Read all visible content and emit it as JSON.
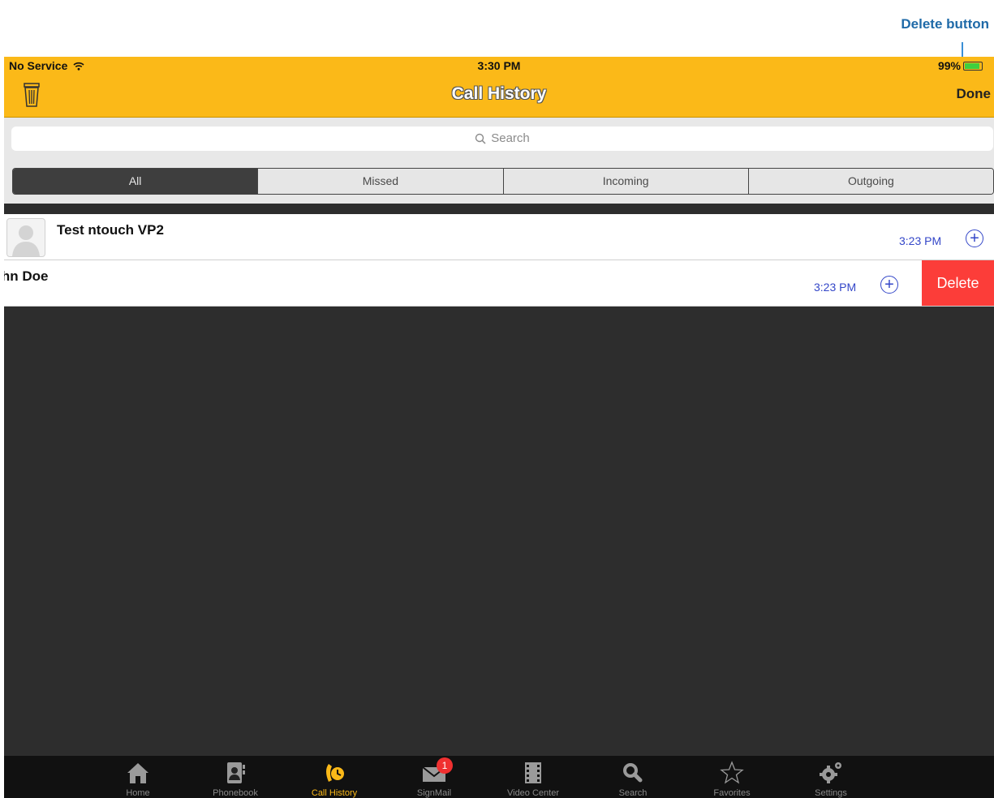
{
  "annotation": {
    "label": "Delete button"
  },
  "status_bar": {
    "carrier": "No Service",
    "time": "3:30 PM",
    "battery": "99%"
  },
  "nav": {
    "title": "Call History",
    "done_label": "Done"
  },
  "search": {
    "placeholder": "Search"
  },
  "segments": [
    {
      "label": "All",
      "active": true
    },
    {
      "label": "Missed",
      "active": false
    },
    {
      "label": "Incoming",
      "active": false
    },
    {
      "label": "Outgoing",
      "active": false
    }
  ],
  "calls": [
    {
      "name": "Test ntouch VP2",
      "time": "3:23 PM"
    },
    {
      "name": "John Doe",
      "time": "3:23 PM",
      "delete_label": "Delete"
    }
  ],
  "tabs": [
    {
      "label": "Home",
      "icon": "home-icon"
    },
    {
      "label": "Phonebook",
      "icon": "phonebook-icon"
    },
    {
      "label": "Call History",
      "icon": "call-history-icon",
      "active": true
    },
    {
      "label": "SignMail",
      "icon": "signmail-icon",
      "badge": "1"
    },
    {
      "label": "Video Center",
      "icon": "video-center-icon"
    },
    {
      "label": "Search",
      "icon": "search-icon"
    },
    {
      "label": "Favorites",
      "icon": "favorites-icon"
    },
    {
      "label": "Settings",
      "icon": "settings-icon"
    }
  ],
  "colors": {
    "accent": "#fbb918",
    "delete": "#fc3d39",
    "link": "#3346c8",
    "annotation": "#1f6aa8"
  }
}
